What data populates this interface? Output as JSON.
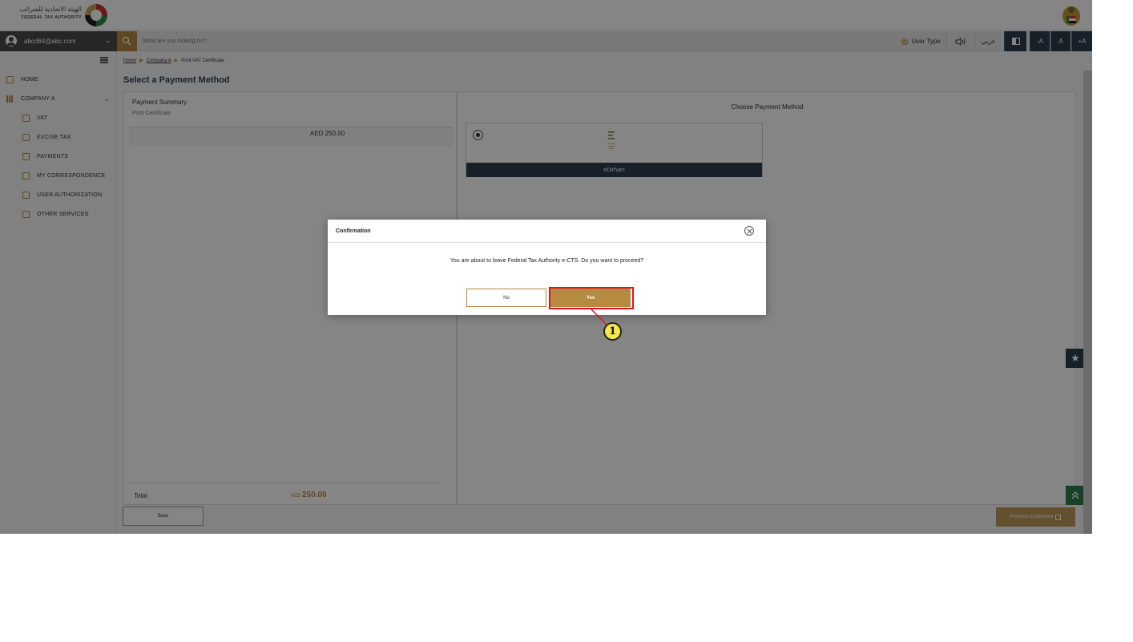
{
  "header": {
    "logo_ar": "الهيئة الاتحادية للضرائب",
    "logo_en": "FEDERAL TAX AUTHORITY"
  },
  "toolbar": {
    "user_email": "abcd64@abc.com",
    "search_placeholder": "What are you looking for?",
    "user_type": "User Type",
    "language": "عربي",
    "font_decrease": "-A",
    "font_normal": "A",
    "font_increase": "+A"
  },
  "sidebar": {
    "items": [
      {
        "label": "HOME",
        "icon": "home-icon"
      },
      {
        "label": "COMPANY A",
        "icon": "grid-icon"
      },
      {
        "label": "VAT",
        "icon": "vat-icon"
      },
      {
        "label": "EXCISE TAX",
        "icon": "excise-icon"
      },
      {
        "label": "PAYMENTS",
        "icon": "payments-icon"
      },
      {
        "label": "MY CORRESPONDENCE",
        "icon": "correspondence-icon"
      },
      {
        "label": "USER AUTHORIZATION",
        "icon": "authorization-icon"
      },
      {
        "label": "OTHER SERVICES",
        "icon": "services-icon"
      }
    ]
  },
  "breadcrumb": {
    "home": "Home",
    "company": "Company A",
    "current": "Print VAT Certificate"
  },
  "page": {
    "title": "Select a Payment Method"
  },
  "summary": {
    "title": "Payment Summary",
    "subtitle": "Print Certificate",
    "amount": "AED 250.00",
    "total_label": "Total",
    "total_currency": "AED",
    "total_value": "250.00"
  },
  "methods": {
    "title": "Choose Payment Method",
    "edirham_label": "eDirham"
  },
  "actions": {
    "back": "Back",
    "proceed": "Proceed to payment"
  },
  "modal": {
    "title": "Confirmation",
    "message": "You are about to leave Federal Tax Authority e-CTS. Do you want to proceed?",
    "no": "No",
    "yes": "Yes"
  },
  "annotation": {
    "step": "1"
  },
  "colors": {
    "gold": "#b68a40",
    "navy": "#2c3e50",
    "highlight": "#e0141e"
  }
}
